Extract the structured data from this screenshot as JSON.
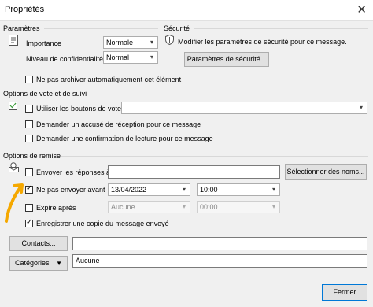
{
  "window": {
    "title": "Propriétés",
    "close_glyph": "✕"
  },
  "parametres": {
    "group_label": "Paramètres",
    "importance_label": "Importance",
    "importance_value": "Normale",
    "confidentialite_label": "Niveau de confidentialité",
    "confidentialite_value": "Normal",
    "archive_label": "Ne pas archiver automatiquement cet élément"
  },
  "securite": {
    "group_label": "Sécurité",
    "info_text": "Modifier les paramètres de sécurité pour ce message.",
    "button_label": "Paramètres de sécurité..."
  },
  "vote": {
    "group_label": "Options de vote et de suivi",
    "use_vote_label": "Utiliser les boutons de vote",
    "vote_value": "",
    "accuse_reception_label": "Demander un accusé de réception pour ce message",
    "confirmation_lecture_label": "Demander une confirmation de lecture pour ce message"
  },
  "remise": {
    "group_label": "Options de remise",
    "envoyer_reponses_label": "Envoyer les réponses à",
    "envoyer_reponses_value": "",
    "select_names_button": "Sélectionner des noms...",
    "ne_pas_envoyer_label": "Ne pas envoyer avant",
    "ne_pas_envoyer_date": "13/04/2022",
    "ne_pas_envoyer_time": "10:00",
    "expire_label": "Expire après",
    "expire_date": "Aucune",
    "expire_time": "00:00",
    "enregistrer_copie_label": "Enregistrer une copie du message envoyé"
  },
  "footer": {
    "contacts_button": "Contacts...",
    "contacts_value": "",
    "categories_button": "Catégories",
    "categories_value": "Aucune",
    "close_button": "Fermer"
  },
  "annotation": {
    "arrow_color": "#f5a800"
  },
  "icons": {
    "importance": "importance-icon",
    "security": "shield-icon",
    "vote": "vote-icon",
    "delivery": "envelope-icon",
    "dropdown": "chevron-down-icon"
  }
}
